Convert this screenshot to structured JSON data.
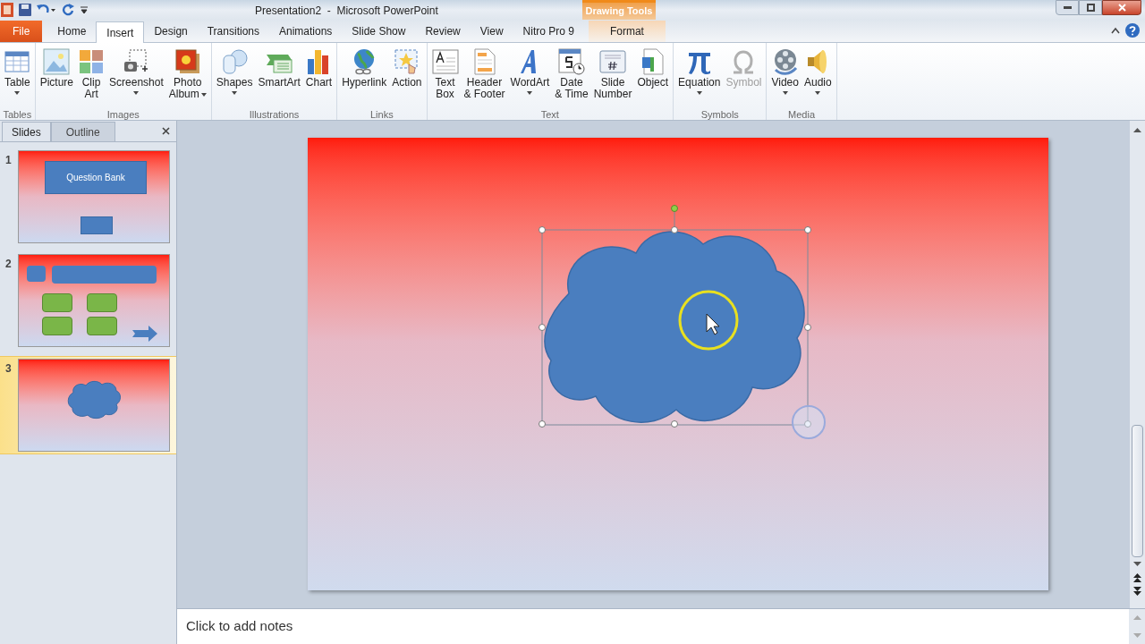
{
  "window": {
    "title": "Presentation2  -  Microsoft PowerPoint",
    "context_group": "Drawing Tools"
  },
  "tabs": [
    {
      "label": "File",
      "kind": "file",
      "selected": false
    },
    {
      "label": "Home",
      "kind": "normal",
      "selected": false
    },
    {
      "label": "Insert",
      "kind": "normal",
      "selected": true
    },
    {
      "label": "Design",
      "kind": "normal",
      "selected": false
    },
    {
      "label": "Transitions",
      "kind": "normal",
      "selected": false
    },
    {
      "label": "Animations",
      "kind": "normal",
      "selected": false
    },
    {
      "label": "Slide Show",
      "kind": "normal",
      "selected": false
    },
    {
      "label": "Review",
      "kind": "normal",
      "selected": false
    },
    {
      "label": "View",
      "kind": "normal",
      "selected": false
    },
    {
      "label": "Nitro Pro 9",
      "kind": "normal",
      "selected": false
    },
    {
      "label": "Format",
      "kind": "contextual",
      "selected": false
    }
  ],
  "ribbon_groups": [
    {
      "label": "Tables",
      "buttons": [
        {
          "lines": [
            "Table"
          ],
          "kind": "table",
          "dropdown": true,
          "disabled": false
        }
      ]
    },
    {
      "label": "Images",
      "buttons": [
        {
          "lines": [
            "Picture"
          ],
          "kind": "picture",
          "dropdown": false,
          "disabled": false
        },
        {
          "lines": [
            "Clip",
            "Art"
          ],
          "kind": "clipart",
          "dropdown": false,
          "disabled": false
        },
        {
          "lines": [
            "Screenshot"
          ],
          "kind": "screenshot",
          "dropdown": true,
          "disabled": false
        },
        {
          "lines": [
            "Photo",
            "Album"
          ],
          "kind": "album",
          "dropdown": true,
          "disabled": false
        }
      ]
    },
    {
      "label": "Illustrations",
      "buttons": [
        {
          "lines": [
            "Shapes"
          ],
          "kind": "shapes",
          "dropdown": true,
          "disabled": false
        },
        {
          "lines": [
            "SmartArt"
          ],
          "kind": "smartart",
          "dropdown": false,
          "disabled": false
        },
        {
          "lines": [
            "Chart"
          ],
          "kind": "chart",
          "dropdown": false,
          "disabled": false
        }
      ]
    },
    {
      "label": "Links",
      "buttons": [
        {
          "lines": [
            "Hyperlink"
          ],
          "kind": "globe",
          "dropdown": false,
          "disabled": false
        },
        {
          "lines": [
            "Action"
          ],
          "kind": "action",
          "dropdown": false,
          "disabled": false
        }
      ]
    },
    {
      "label": "Text",
      "buttons": [
        {
          "lines": [
            "Text",
            "Box"
          ],
          "kind": "textbox",
          "dropdown": false,
          "disabled": false
        },
        {
          "lines": [
            "Header",
            "& Footer"
          ],
          "kind": "header",
          "dropdown": false,
          "disabled": false
        },
        {
          "lines": [
            "WordArt"
          ],
          "kind": "wordart",
          "dropdown": true,
          "disabled": false
        },
        {
          "lines": [
            "Date",
            "& Time"
          ],
          "kind": "date",
          "dropdown": false,
          "disabled": false
        },
        {
          "lines": [
            "Slide",
            "Number"
          ],
          "kind": "number",
          "dropdown": false,
          "disabled": false
        },
        {
          "lines": [
            "Object"
          ],
          "kind": "object",
          "dropdown": false,
          "disabled": false
        }
      ]
    },
    {
      "label": "Symbols",
      "buttons": [
        {
          "lines": [
            "Equation"
          ],
          "kind": "pi",
          "dropdown": true,
          "disabled": false
        },
        {
          "lines": [
            "Symbol"
          ],
          "kind": "omega",
          "dropdown": false,
          "disabled": true
        }
      ]
    },
    {
      "label": "Media",
      "buttons": [
        {
          "lines": [
            "Video"
          ],
          "kind": "film",
          "dropdown": true,
          "disabled": false
        },
        {
          "lines": [
            "Audio"
          ],
          "kind": "speaker",
          "dropdown": true,
          "disabled": false
        }
      ]
    }
  ],
  "pane_tabs": [
    {
      "label": "Slides",
      "selected": true
    },
    {
      "label": "Outline",
      "selected": false
    }
  ],
  "slides": [
    {
      "number": "1",
      "kind": "title",
      "title": "Question Bank",
      "selected": false
    },
    {
      "number": "2",
      "kind": "quiz",
      "selected": false
    },
    {
      "number": "3",
      "kind": "cloud",
      "selected": true
    }
  ],
  "notes": {
    "placeholder": "Click to add notes"
  }
}
